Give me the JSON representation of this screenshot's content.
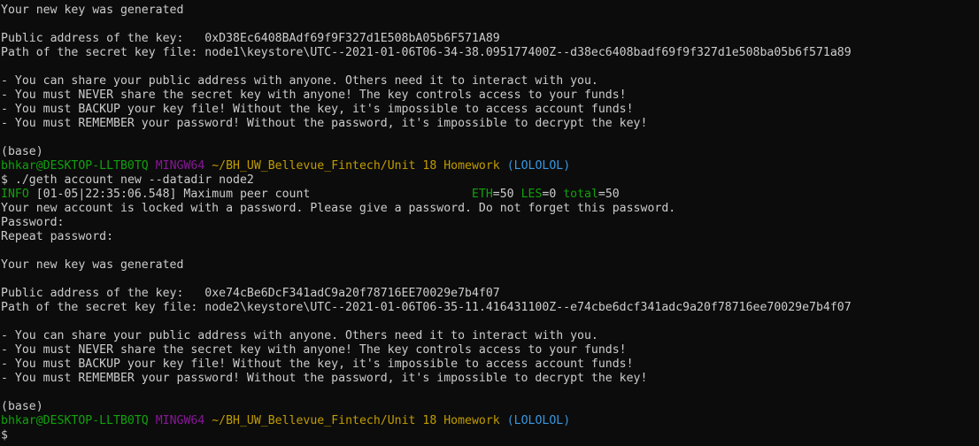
{
  "terminal": {
    "block1": {
      "generated_msg": "Your new key was generated",
      "public_label": "Public address of the key:   ",
      "public_address": "0xD38Ec6408BAdf69f9F327d1E508bA05b6F571A89",
      "path_label": "Path of the secret key file: ",
      "path": "node1\\keystore\\UTC--2021-01-06T06-34-38.095177400Z--d38ec6408badf69f9f327d1e508ba05b6f571a89",
      "warning1": "- You can share your public address with anyone. Others need it to interact with you.",
      "warning2": "- You must NEVER share the secret key with anyone! The key controls access to your funds!",
      "warning3": "- You must BACKUP your key file! Without the key, it's impossible to access account funds!",
      "warning4": "- You must REMEMBER your password! Without the password, it's impossible to decrypt the key!",
      "env": "(base)"
    },
    "prompt1": {
      "user_host": "bhkar@DESKTOP-LLTB0TQ",
      "shell": "MINGW64",
      "path": "~/BH_UW_Bellevue_Fintech/Unit 18 Homework",
      "branch": "(LOLOLOL)",
      "symbol": "$",
      "command": "./geth account new --datadir node2"
    },
    "log": {
      "level": "INFO",
      "message": " [01-05|22:35:06.548] Maximum peer count                       ",
      "eth_key": "ETH",
      "eth_val": "=50 ",
      "les_key": "LES",
      "les_val": "=0 ",
      "total_key": "total",
      "total_val": "=50"
    },
    "locked_msg": "Your new account is locked with a password. Please give a password. Do not forget this password.",
    "password_prompt": "Password:",
    "repeat_prompt": "Repeat password:",
    "block2": {
      "generated_msg": "Your new key was generated",
      "public_label": "Public address of the key:   ",
      "public_address": "0xe74cBe6DcF341adC9a20f78716EE70029e7b4f07",
      "path_label": "Path of the secret key file: ",
      "path": "node2\\keystore\\UTC--2021-01-06T06-35-11.416431100Z--e74cbe6dcf341adc9a20f78716ee70029e7b4f07",
      "warning1": "- You can share your public address with anyone. Others need it to interact with you.",
      "warning2": "- You must NEVER share the secret key with anyone! The key controls access to your funds!",
      "warning3": "- You must BACKUP your key file! Without the key, it's impossible to access account funds!",
      "warning4": "- You must REMEMBER your password! Without the password, it's impossible to decrypt the key!",
      "env": "(base)"
    },
    "prompt2": {
      "user_host": "bhkar@DESKTOP-LLTB0TQ",
      "shell": "MINGW64",
      "path": "~/BH_UW_Bellevue_Fintech/Unit 18 Homework",
      "branch": "(LOLOLOL)",
      "symbol": "$"
    }
  },
  "colors": {
    "background": "#0c0c0c",
    "text": "#cccccc",
    "green": "#13a10e",
    "magenta": "#881798",
    "yellow": "#c19c00",
    "cyan": "#3a96dd"
  }
}
